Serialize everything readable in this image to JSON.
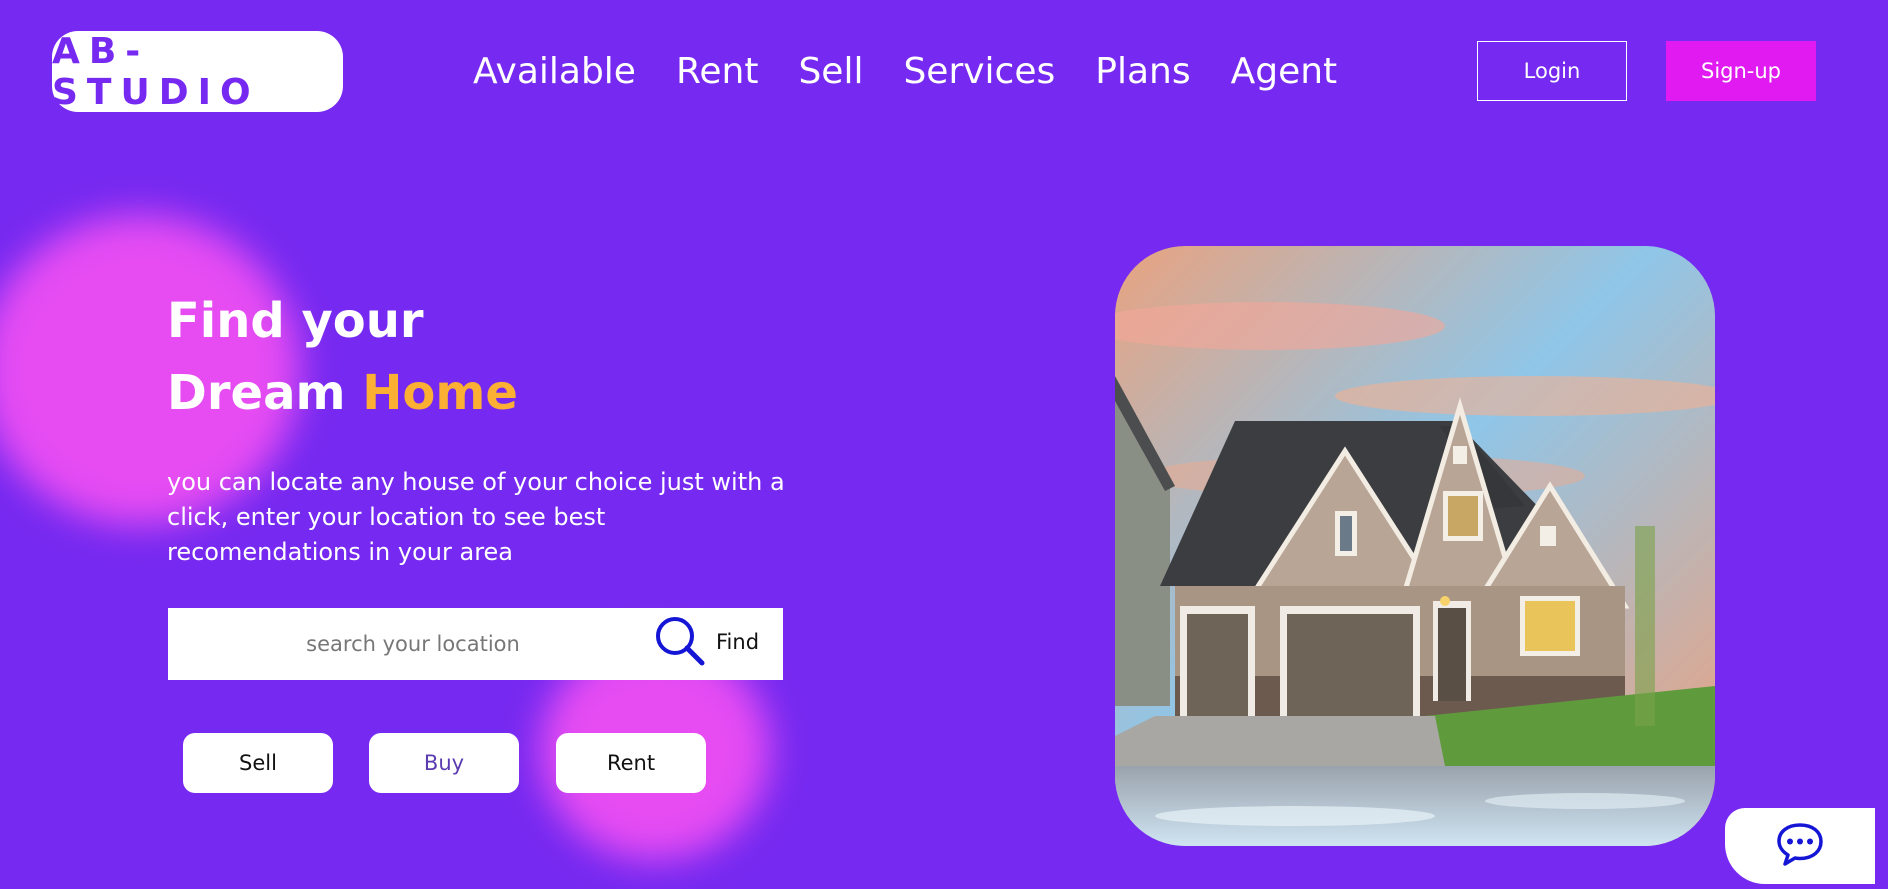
{
  "brand": {
    "logo": "AB-STUDIO"
  },
  "nav": {
    "items": [
      "Available",
      "Rent",
      "Sell",
      "Services",
      "Plans",
      "Agent"
    ]
  },
  "auth": {
    "login": "Login",
    "signup": "Sign-up"
  },
  "hero": {
    "title_line1": "Find your",
    "title_line2_start": "Dream",
    "title_line2_accent": "Home",
    "description": "you can locate any house of your choice just with a click, enter your location to see best recomendations in your area"
  },
  "search": {
    "placeholder": "search your location",
    "value": "",
    "button_label": "Find",
    "icon": "search-icon"
  },
  "actions": {
    "sell": "Sell",
    "buy": "Buy",
    "rent": "Rent"
  },
  "chat": {
    "icon": "chat-bubble-icon"
  },
  "colors": {
    "background": "#7629f0",
    "accent": "#fbb034",
    "signup": "#e01af0",
    "blob": "#ec4ef3",
    "icon_blue": "#1515d6"
  }
}
